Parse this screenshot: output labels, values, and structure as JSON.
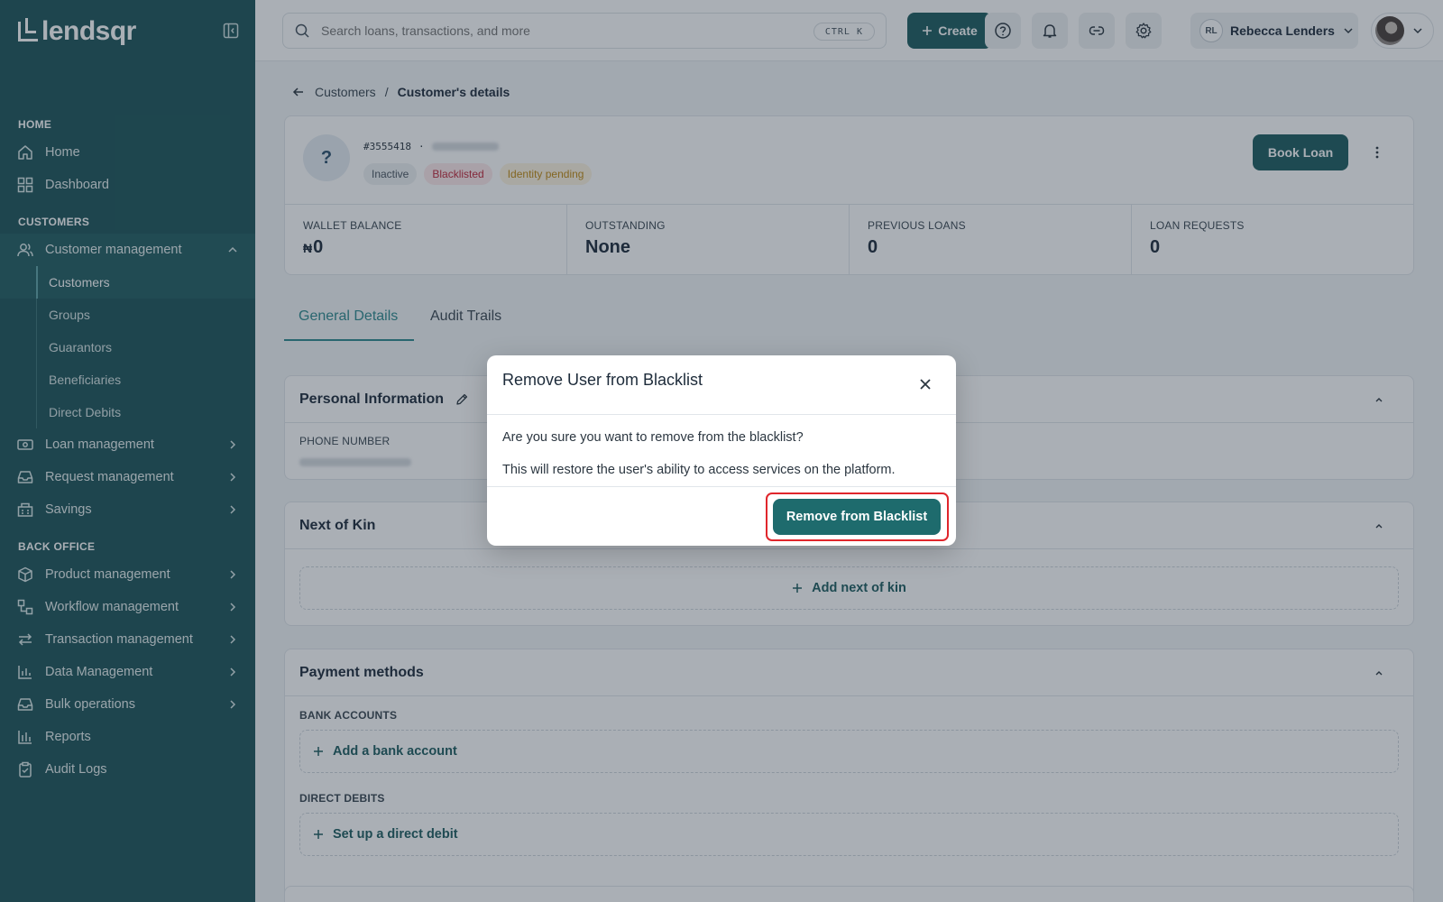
{
  "app": {
    "name": "lendsqr"
  },
  "sidebar": {
    "sections": [
      {
        "title": "HOME"
      },
      {
        "title": "CUSTOMERS"
      },
      {
        "title": "BACK OFFICE"
      }
    ],
    "home_items": [
      {
        "label": "Home",
        "icon": "home-icon"
      },
      {
        "label": "Dashboard",
        "icon": "dashboard-icon"
      }
    ],
    "customer_management": {
      "label": "Customer management",
      "icon": "users-icon",
      "expanded": true
    },
    "customer_sub": [
      "Customers",
      "Groups",
      "Guarantors",
      "Beneficiaries",
      "Direct Debits"
    ],
    "customer_items": [
      {
        "label": "Loan management",
        "icon": "loan-icon"
      },
      {
        "label": "Request management",
        "icon": "inbox-icon"
      },
      {
        "label": "Savings",
        "icon": "savings-icon"
      }
    ],
    "backoffice_items": [
      {
        "label": "Product management",
        "icon": "box-icon"
      },
      {
        "label": "Workflow management",
        "icon": "workflow-icon"
      },
      {
        "label": "Transaction management",
        "icon": "transfer-icon"
      },
      {
        "label": "Data Management",
        "icon": "chart-icon"
      },
      {
        "label": "Bulk operations",
        "icon": "inbox-icon"
      },
      {
        "label": "Reports",
        "icon": "reports-icon"
      },
      {
        "label": "Audit Logs",
        "icon": "clipboard-icon"
      }
    ]
  },
  "topbar": {
    "search_placeholder": "Search loans, transactions, and more",
    "shortcut": "CTRL K",
    "create_label": "Create",
    "user_initials": "RL",
    "user_name": "Rebecca Lenders"
  },
  "breadcrumb": {
    "parent": "Customers",
    "separator": "/",
    "current": "Customer's details"
  },
  "customer": {
    "avatar_text": "?",
    "id": "#3555418",
    "id_separator": "·",
    "badges": [
      "Inactive",
      "Blacklisted",
      "Identity pending"
    ],
    "book_loan_label": "Book Loan",
    "stats": [
      {
        "label": "WALLET BALANCE",
        "currency": "₦",
        "value": "0"
      },
      {
        "label": "OUTSTANDING",
        "currency": "",
        "value": "None"
      },
      {
        "label": "PREVIOUS LOANS",
        "currency": "",
        "value": "0"
      },
      {
        "label": "LOAN REQUESTS",
        "currency": "",
        "value": "0"
      }
    ]
  },
  "tabs": [
    {
      "label": "General Details",
      "active": true
    },
    {
      "label": "Audit Trails",
      "active": false
    }
  ],
  "sections": {
    "personal": {
      "title": "Personal Information",
      "phone_label": "PHONE NUMBER"
    },
    "kin": {
      "title": "Next of Kin",
      "add_label": "Add next of kin"
    },
    "payment": {
      "title": "Payment methods",
      "bank_label": "BANK ACCOUNTS",
      "add_bank": "Add a bank account",
      "debit_label": "DIRECT DEBITS",
      "add_debit": "Set up a direct debit"
    }
  },
  "modal": {
    "title": "Remove User from Blacklist",
    "line1": "Are you sure you want to remove from the blacklist?",
    "line2": "This will restore the user's ability to access services on the platform.",
    "confirm_label": "Remove from Blacklist"
  },
  "colors": {
    "sidebar": "#1e5559",
    "primary": "#1e5c5f",
    "tab_active": "#2e8a8e",
    "danger_badge": "#c0283a",
    "focus_ring": "#e0262c"
  }
}
